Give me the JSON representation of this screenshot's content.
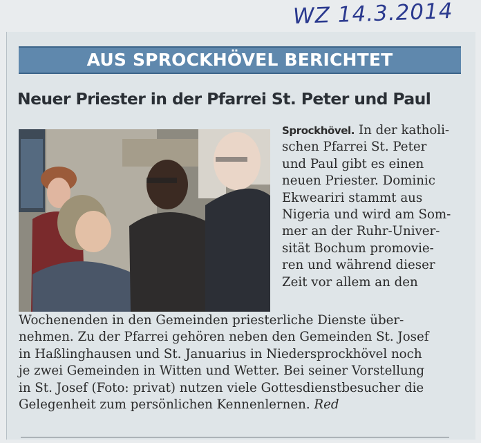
{
  "handwritten_note": "WZ 14.3.2014",
  "banner": "AUS SPROCKHÖVEL BERICHTET",
  "headline": "Neuer Priester in der Pfarrei St. Peter und Paul",
  "article": {
    "dateline": "Sprockhövel.",
    "column_lines": [
      "In der katholi-",
      "schen Pfarrei St. Peter",
      "und Paul gibt es einen",
      "neuen Priester. Dominic",
      "Ekweariri stammt aus",
      "Nigeria und wird am Som-",
      "mer an der Ruhr-Univer-",
      "sität Bochum promovie-",
      "ren und während dieser",
      "Zeit vor allem an den"
    ],
    "full_lines": [
      "Wochenenden in den Gemeinden priesterliche Dienste über-",
      "nehmen. Zu der Pfarrei gehören neben den Gemeinden St. Josef",
      "in Haßlinghausen und St. Januarius in Niedersprockhövel noch",
      "je zwei Gemeinden in Witten und Wetter. Bei seiner Vorstellung",
      "in St. Josef (Foto: privat) nutzen viele Gottesdienstbesucher die",
      "Gelegenheit zum persönlichen Kennenlernen."
    ],
    "author": "Red"
  },
  "colors": {
    "banner": "#5f88ad",
    "handwriting": "#2b3a8f",
    "paper": "#dfe5e8"
  }
}
